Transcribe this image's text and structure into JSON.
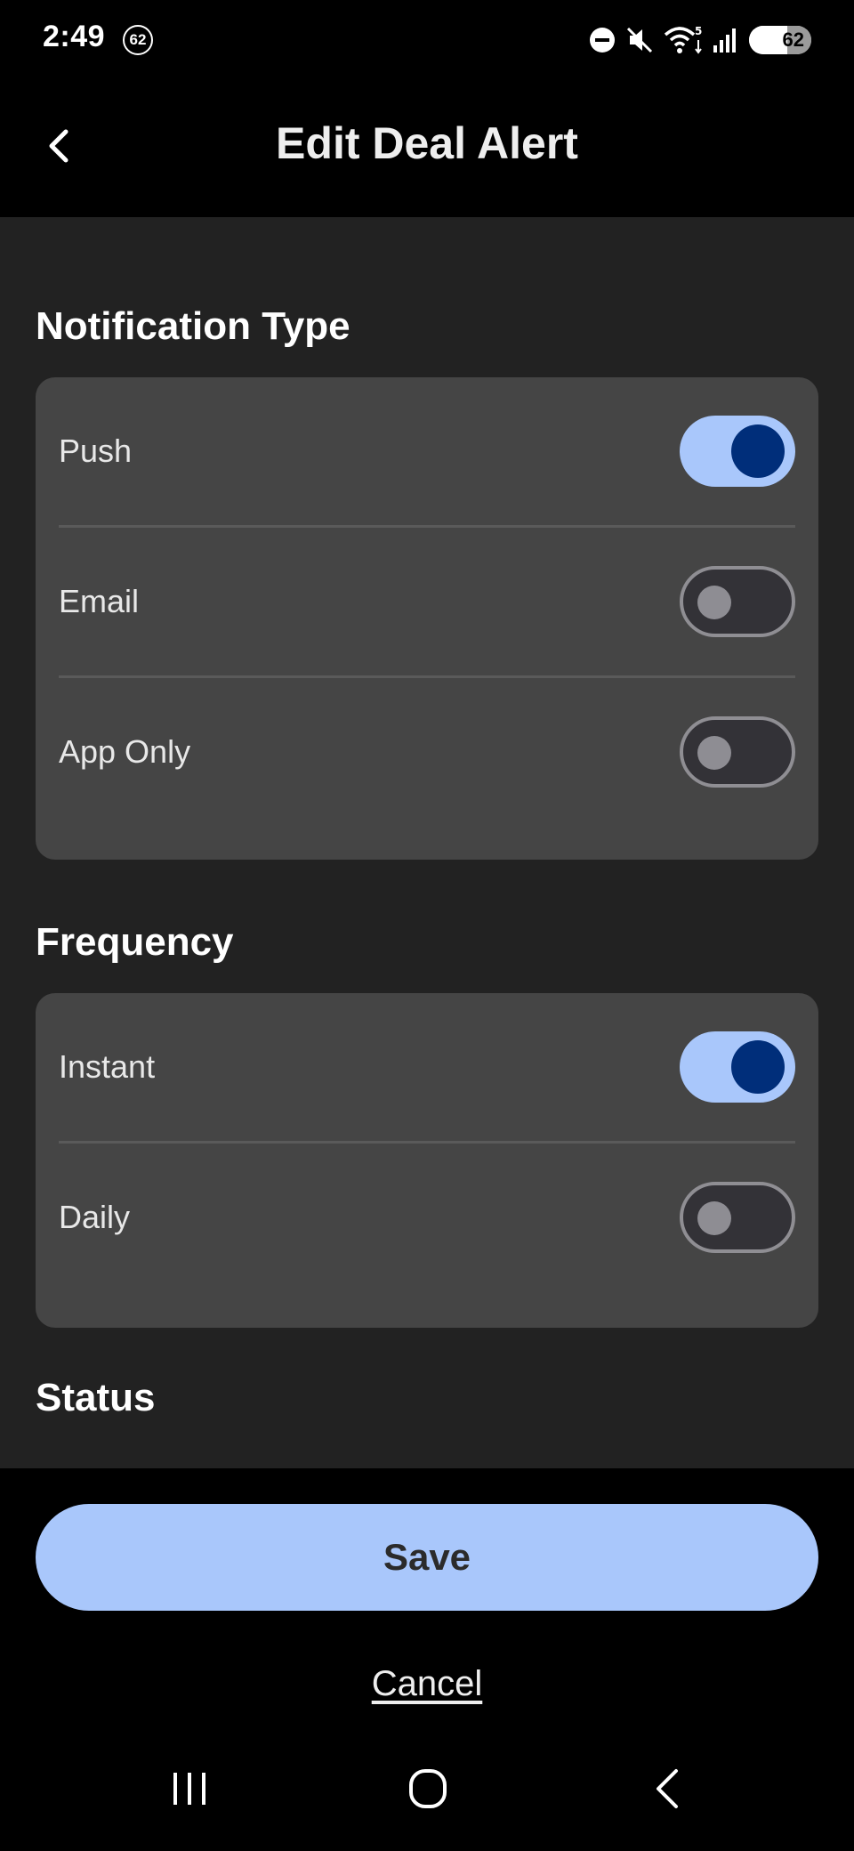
{
  "status_bar": {
    "time": "2:49",
    "notification_count": "62",
    "battery_level": "62",
    "icons": [
      "dnd-icon",
      "mute-icon",
      "wifi-icon",
      "signal-icon",
      "battery-icon"
    ]
  },
  "app_bar": {
    "title": "Edit Deal Alert",
    "back_icon": "chevron-left-icon"
  },
  "sections": {
    "notification_type": {
      "title": "Notification Type",
      "items": [
        {
          "label": "Push",
          "enabled": true
        },
        {
          "label": "Email",
          "enabled": false
        },
        {
          "label": "App Only",
          "enabled": false
        }
      ]
    },
    "frequency": {
      "title": "Frequency",
      "items": [
        {
          "label": "Instant",
          "enabled": true
        },
        {
          "label": "Daily",
          "enabled": false
        }
      ]
    },
    "status": {
      "title": "Status"
    }
  },
  "footer": {
    "save_label": "Save",
    "cancel_label": "Cancel"
  },
  "colors": {
    "accent": "#a9c7fb",
    "knob_on": "#002e7a",
    "card": "#454545",
    "background": "#222222"
  },
  "nav_bar": {
    "icons": [
      "recents-icon",
      "home-icon",
      "back-icon"
    ]
  }
}
